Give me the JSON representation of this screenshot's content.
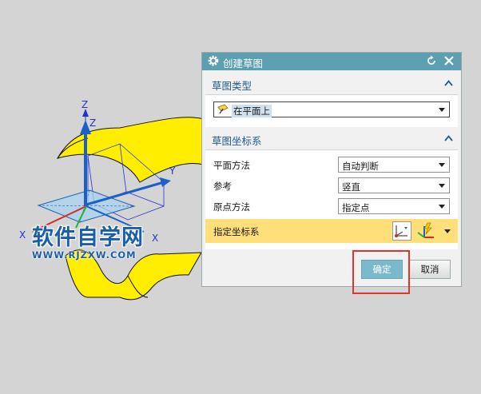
{
  "viewport": {
    "axis_z1": "Z",
    "axis_z2": "Z",
    "axis_y": "Y",
    "axis_x1": "X",
    "axis_x2": "X"
  },
  "watermark": {
    "title": "软件自学网",
    "url": "WWW.RJZXW.COM"
  },
  "dialog": {
    "title": "创建草图",
    "sketch_type": {
      "header": "草图类型",
      "selected": "在平面上"
    },
    "sketch_csys": {
      "header": "草图坐标系",
      "rows": [
        {
          "label": "平面方法",
          "value": "自动判断"
        },
        {
          "label": "参考",
          "value": "竖直"
        },
        {
          "label": "原点方法",
          "value": "指定点"
        }
      ],
      "specify_label": "指定坐标系"
    },
    "ok_label": "确定",
    "cancel_label": "取消"
  },
  "colors": {
    "title_bar": "#5c9fb0",
    "surface": "#ffee00",
    "highlight": "#e0342f",
    "ok_button": "#7ab8cb"
  }
}
